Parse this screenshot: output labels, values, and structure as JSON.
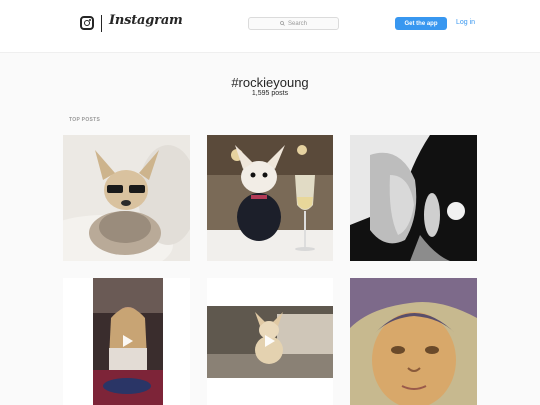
{
  "header": {
    "brand": "Instagram",
    "search_placeholder": "Search",
    "get_app_label": "Get the app",
    "login_label": "Log in"
  },
  "tag": {
    "title": "#rockieyoung",
    "post_count": "1,595 posts"
  },
  "section": {
    "top_posts_label": "TOP POSTS"
  },
  "posts": [
    {
      "kind": "photo",
      "subject": "chihuahua-glasses"
    },
    {
      "kind": "photo",
      "subject": "chihuahua-wine"
    },
    {
      "kind": "photo",
      "subject": "bw-woman-portrait"
    },
    {
      "kind": "video",
      "subject": "girl-in-car"
    },
    {
      "kind": "video",
      "subject": "dog-on-couch"
    },
    {
      "kind": "photo",
      "subject": "child-painting"
    }
  ],
  "colors": {
    "accent": "#3897f0",
    "text": "#262626",
    "muted": "#999999",
    "background": "#fafafa"
  }
}
